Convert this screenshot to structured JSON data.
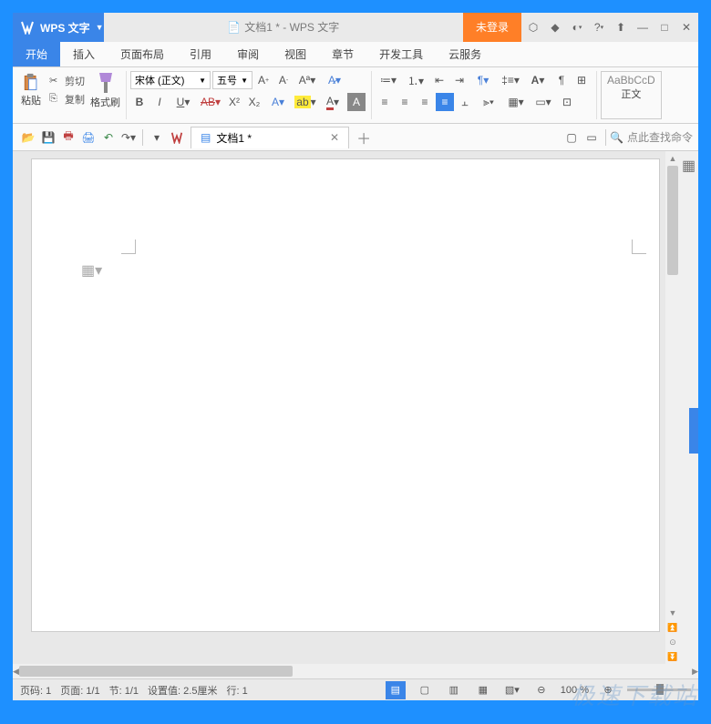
{
  "title": {
    "app_name": "WPS 文字",
    "doc_title": "文档1 * - WPS 文字",
    "login_label": "未登录"
  },
  "menu": {
    "tabs": [
      "开始",
      "插入",
      "页面布局",
      "引用",
      "审阅",
      "视图",
      "章节",
      "开发工具",
      "云服务"
    ]
  },
  "ribbon": {
    "paste_label": "粘贴",
    "cut_label": "剪切",
    "copy_label": "复制",
    "format_painter_label": "格式刷",
    "font_name": "宋体 (正文)",
    "font_size": "五号",
    "style_sample": "AaBbCcD",
    "style_name": "正文"
  },
  "tabs": {
    "doc_name": "文档1 *"
  },
  "search": {
    "placeholder": "点此查找命令"
  },
  "status": {
    "page_num": "页码: 1",
    "page_of": "页面: 1/1",
    "section": "节: 1/1",
    "setting": "设置值: 2.5厘米",
    "line": "行: 1",
    "zoom": "100 %"
  },
  "watermark": "极速下载站"
}
